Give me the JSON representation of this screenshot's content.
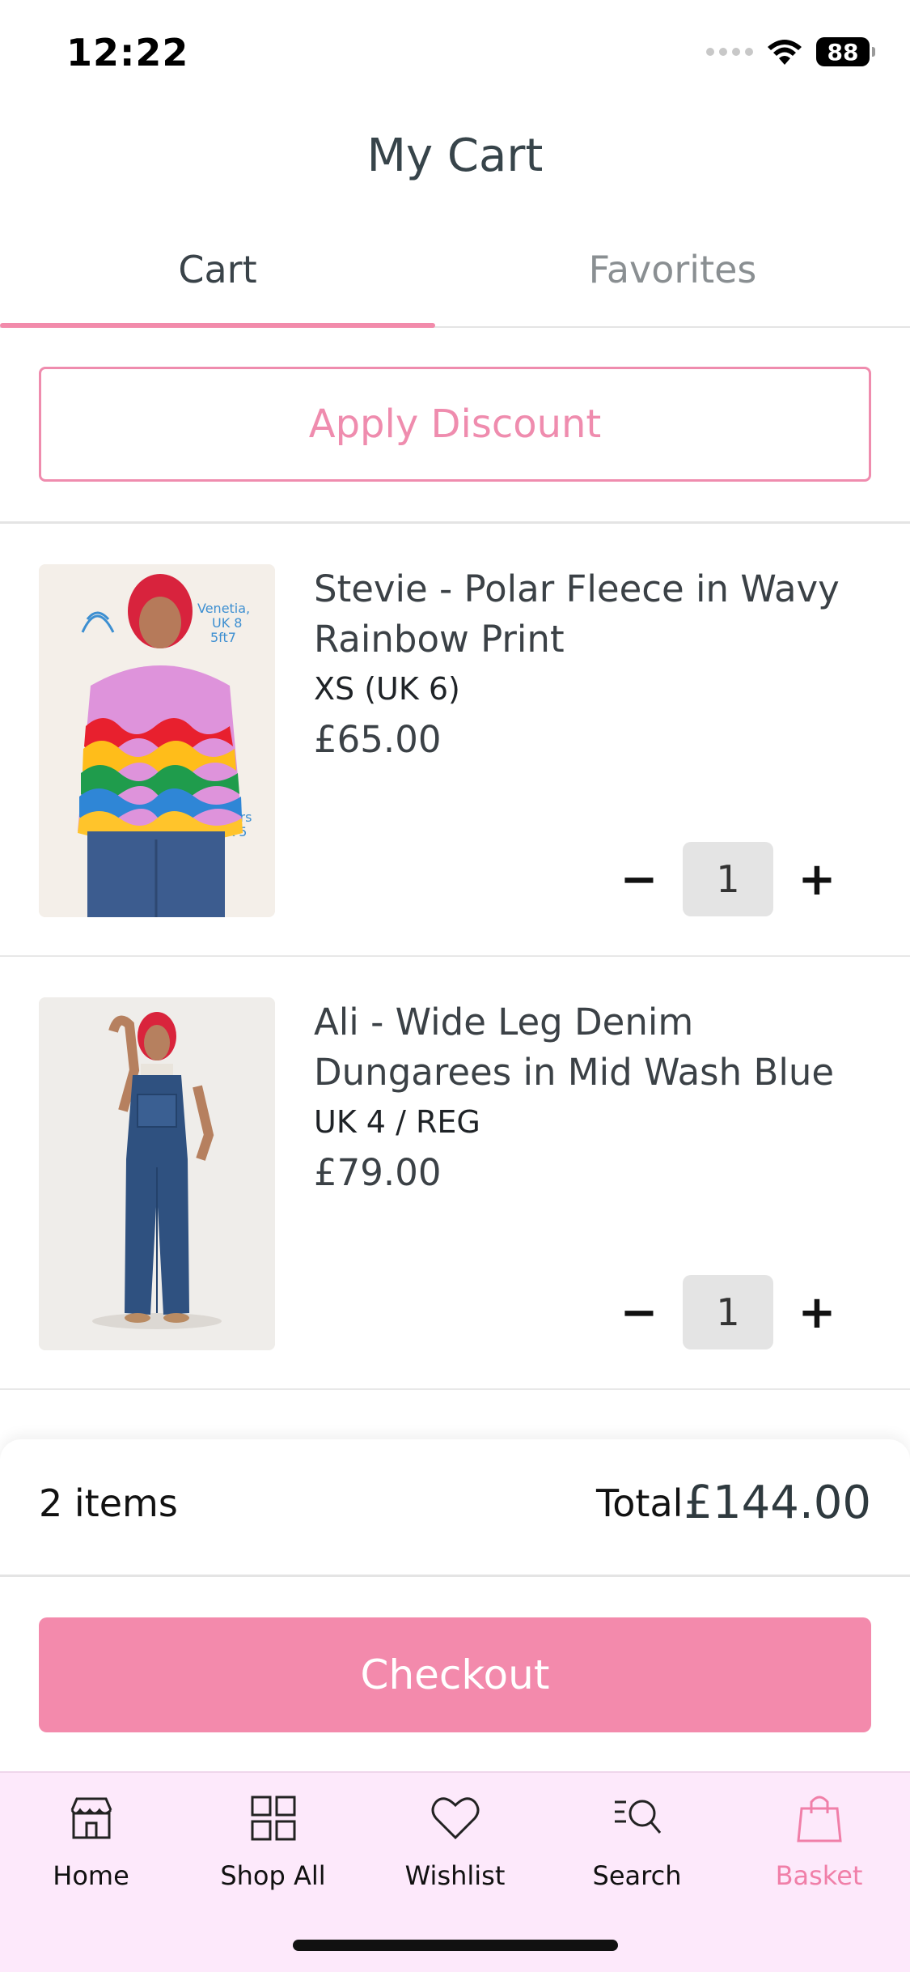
{
  "status_bar": {
    "time": "12:22",
    "battery": "88"
  },
  "header": {
    "title": "My Cart"
  },
  "tabs": [
    {
      "label": "Cart",
      "active": true
    },
    {
      "label": "Favorites",
      "active": false
    }
  ],
  "discount": {
    "label": "Apply Discount"
  },
  "items": [
    {
      "name": "Stevie - Polar Fleece in Wavy Rainbow Print",
      "size": "XS (UK 6)",
      "price": "£65.00",
      "quantity": "1",
      "image_icon": "product-photo-rainbow-fleece"
    },
    {
      "name": "Ali - Wide Leg Denim Dungarees in Mid Wash Blue",
      "size": "UK 4 / REG",
      "price": "£79.00",
      "quantity": "1",
      "image_icon": "product-photo-denim-dungarees"
    }
  ],
  "qty_controls": {
    "minus": "−",
    "plus": "+"
  },
  "summary": {
    "item_count": "2 items",
    "total_label": "Total",
    "total_value": "£144.00",
    "checkout_label": "Checkout"
  },
  "nav": [
    {
      "label": "Home",
      "icon": "store-icon"
    },
    {
      "label": "Shop All",
      "icon": "grid-icon"
    },
    {
      "label": "Wishlist",
      "icon": "heart-icon"
    },
    {
      "label": "Search",
      "icon": "search-list-icon"
    },
    {
      "label": "Basket",
      "icon": "bag-icon",
      "active": true
    }
  ],
  "colors": {
    "accent": "#f38aac",
    "nav_bg": "#fde9fb"
  }
}
